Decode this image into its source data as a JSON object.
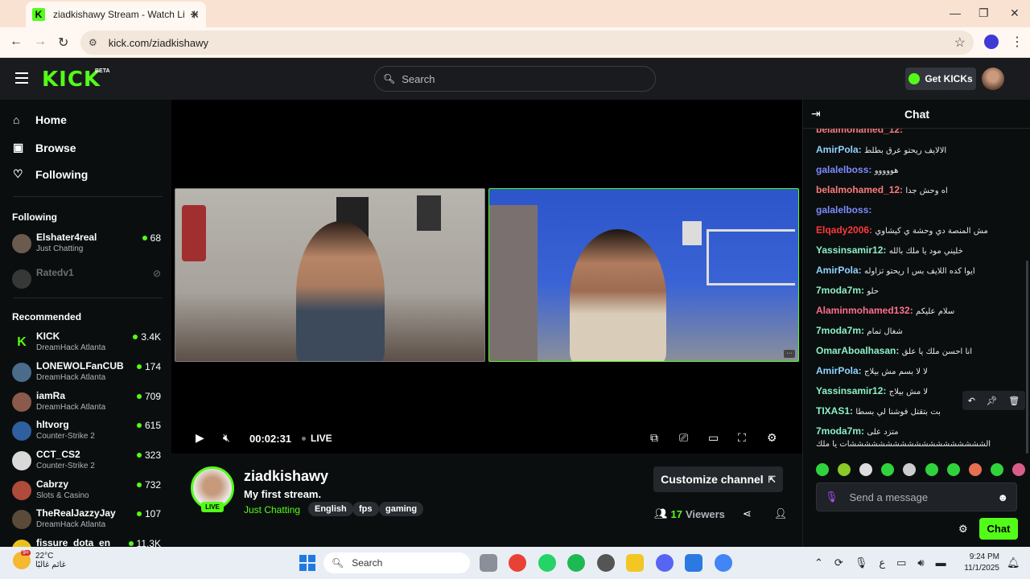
{
  "browser": {
    "tab_title": "ziadkishawy Stream - Watch Live",
    "url": "kick.com/ziadkishawy",
    "new_tab_glyph": "+",
    "close_glyph": "✕"
  },
  "header": {
    "logo": "KICK",
    "logo_badge": "BETA",
    "search_placeholder": "Search",
    "get_kicks_label": "Get KICKs"
  },
  "sidebar": {
    "nav": [
      {
        "label": "Home",
        "icon": "home-icon"
      },
      {
        "label": "Browse",
        "icon": "browse-icon"
      },
      {
        "label": "Following",
        "icon": "heart-icon"
      }
    ],
    "following_title": "Following",
    "following": [
      {
        "name": "Elshater4real",
        "category": "Just Chatting",
        "viewers": "68"
      },
      {
        "name": "Ratedv1",
        "category": "",
        "viewers": ""
      }
    ],
    "recommended_title": "Recommended",
    "recommended": [
      {
        "name": "KICK",
        "category": "DreamHack Atlanta",
        "viewers": "3.4K"
      },
      {
        "name": "LONEWOLFanCUB",
        "category": "DreamHack Atlanta",
        "viewers": "174"
      },
      {
        "name": "iamRa",
        "category": "DreamHack Atlanta",
        "viewers": "709"
      },
      {
        "name": "hltvorg",
        "category": "Counter-Strike 2",
        "viewers": "615"
      },
      {
        "name": "CCT_CS2",
        "category": "Counter-Strike 2",
        "viewers": "323"
      },
      {
        "name": "Cabrzy",
        "category": "Slots & Casino",
        "viewers": "732"
      },
      {
        "name": "TheRealJazzyJay",
        "category": "DreamHack Atlanta",
        "viewers": "107"
      },
      {
        "name": "fissure_dota_en",
        "category": "",
        "viewers": "11.3K"
      }
    ]
  },
  "player": {
    "time": "00:02:31",
    "live_label": "LIVE"
  },
  "channel": {
    "name": "ziadkishawy",
    "live_badge": "LIVE",
    "stream_title": "My first stream.",
    "category": "Just Chatting",
    "tags": [
      "English",
      "fps",
      "gaming"
    ],
    "customize_label": "Customize channel",
    "viewer_count": "17",
    "viewers_label": "Viewers"
  },
  "chat": {
    "title": "Chat",
    "messages": [
      {
        "user": "belalmohamed_12:",
        "text": "",
        "color": "#fb7a7a"
      },
      {
        "user": "AmirPola:",
        "text": "الالايف ريحتو عرق بطلط",
        "color": "#8fd4ff"
      },
      {
        "user": "galalelboss:",
        "text": "هووووو",
        "color": "#7c8cff"
      },
      {
        "user": "belalmohamed_12:",
        "text": "اه وحش جدا",
        "color": "#fb7a7a"
      },
      {
        "user": "galalelboss:",
        "text": "",
        "color": "#7c8cff"
      },
      {
        "user": "Elqady2006:",
        "text": "مش المنصة دي وحشة ي كيشاوي",
        "color": "#ff3838"
      },
      {
        "user": "Yassinsamir12:",
        "text": "خليني مود يا ملك بالله",
        "color": "#8cf0c8"
      },
      {
        "user": "AmirPola:",
        "text": "ايوا كده اللايف بس ا ريحتو تزاوله",
        "color": "#8fd4ff"
      },
      {
        "user": "7moda7m:",
        "text": "حلو",
        "color": "#8cf0c8"
      },
      {
        "user": "Alaminmohamed132:",
        "text": "سلام عليكم",
        "color": "#ff6f8f"
      },
      {
        "user": "7moda7m:",
        "text": "شغال تمام",
        "color": "#8cf0c8"
      },
      {
        "user": "OmarAboalhasan:",
        "text": "انا احسن ملك يا علق",
        "color": "#8cf0c8"
      },
      {
        "user": "AmirPola:",
        "text": "لا لا بسم مش بيلاج",
        "color": "#8fd4ff"
      },
      {
        "user": "Yassinsamir12:",
        "text": "لا مش بيلاج",
        "color": "#8cf0c8"
      },
      {
        "user": "TIXAS1:",
        "text": "بت بتقتل فوشنا لي بسطا",
        "color": "#8cf0c8"
      },
      {
        "user": "7moda7m:",
        "text": "متزد على",
        "color": "#8cf0c8"
      },
      {
        "user": "",
        "text": "الشششششششششششششششششششات يا ملك",
        "color": "#8cf0c8"
      }
    ],
    "input_placeholder": "Send a message",
    "send_label": "Chat"
  },
  "taskbar": {
    "temperature": "22°C",
    "weather_text": "غائم غالبًا",
    "weather_badge": "9+",
    "search_placeholder": "Search",
    "lang": "ع",
    "time": "9:24 PM",
    "date": "11/1/2025"
  }
}
